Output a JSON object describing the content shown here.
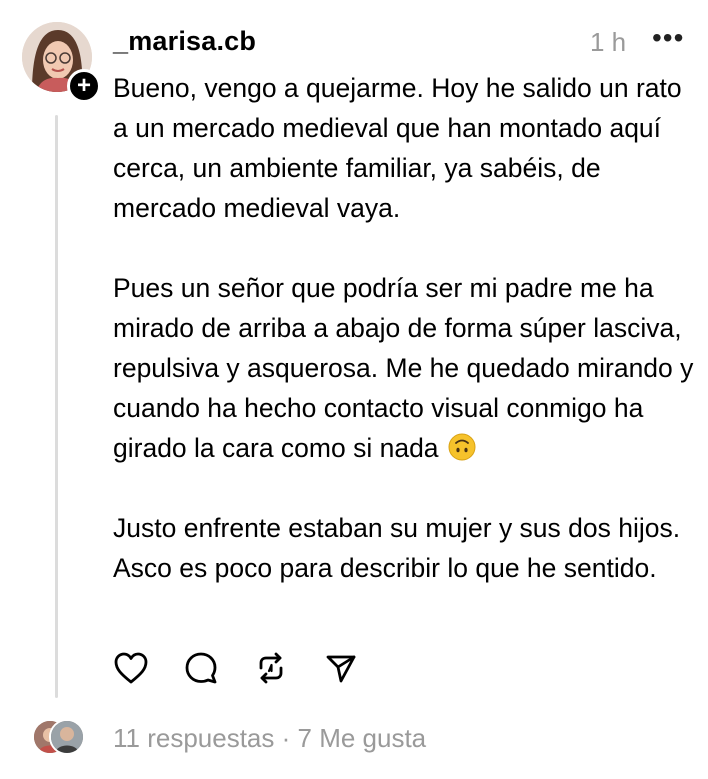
{
  "post": {
    "username": "_marisa.cb",
    "time": "1 h",
    "more": "•••",
    "follow_glyph": "+",
    "paragraphs": [
      "Bueno, vengo a quejarme. Hoy he salido un rato a un mercado medieval que han montado aquí cerca, un ambiente familiar, ya sabéis, de mercado medieval vaya.",
      "Pues un señor que podría ser mi padre me ha mirado de arriba a abajo de forma súper lasciva, repulsiva y asquerosa. Me he quedado mirando y cuando ha hecho contacto visual conmigo ha girado la cara como si nada",
      "Justo enfrente estaban su mujer y sus dos hijos. Asco es poco para describir lo que he sentido."
    ],
    "emoji": "upside-down-face"
  },
  "actions": [
    "heart-icon",
    "comment-icon",
    "repost-icon",
    "share-icon"
  ],
  "footer": {
    "replies": "11 respuestas",
    "separator": " · ",
    "likes": "7 Me gusta"
  },
  "colors": {
    "text": "#000000",
    "muted": "#9a9a9a",
    "thread_line": "#dcdcdc",
    "emoji": "#f6c22b"
  }
}
